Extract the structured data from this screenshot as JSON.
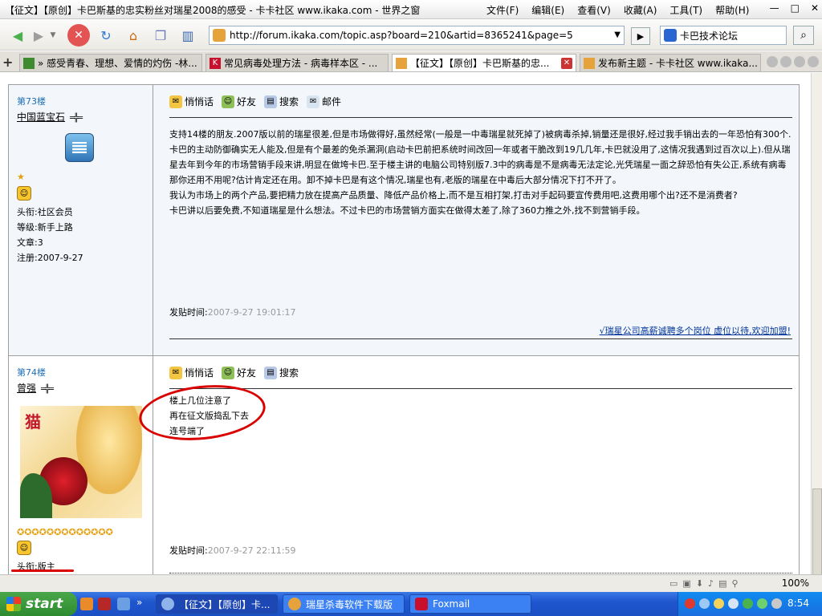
{
  "window": {
    "title": "【征文】【原创】卡巴斯基的忠实粉丝对瑞星2008的感受 - 卡卡社区 www.ikaka.com - 世界之窗",
    "menus": [
      "文件(F)",
      "编辑(E)",
      "查看(V)",
      "收藏(A)",
      "工具(T)",
      "帮助(H)"
    ],
    "controls": [
      "—",
      "□",
      "✕"
    ]
  },
  "toolbar": {
    "url": "http://forum.ikaka.com/topic.asp?board=210&artid=8365241&page=5",
    "search_text": "卡巴技术论坛"
  },
  "tabs": [
    {
      "label": "» 感受青春、理想、爱情的灼伤 -林...",
      "icon_color": "#3e8a2e"
    },
    {
      "label": "常见病毒处理方法 - 病毒样本区 - ...",
      "icon_color": "#c8102e"
    },
    {
      "label": "【征文】【原创】卡巴斯基的忠...",
      "icon_color": "#e7a33b",
      "active": true
    },
    {
      "label": "发布新主题 - 卡卡社区 www.ikaka...",
      "icon_color": "#e7a33b"
    }
  ],
  "actions": {
    "whisper": "悄悄话",
    "friend": "好友",
    "search": "搜索",
    "mail": "邮件"
  },
  "posts": [
    {
      "floor": "第73楼",
      "username": "中国蓝宝石",
      "title": "头衔:社区会员",
      "level": "等级:新手上路",
      "articles": "文章:3",
      "registered": "注册:2007-9-27",
      "body": [
        "支持14楼的朋友.2007版以前的瑞星很差,但是市场做得好,虽然经常(一般是一中毒瑞星就死掉了)被病毒杀掉,销量还是很好,经过我手销出去的一年恐怕有300个.卡巴的主动防御确实无人能及,但是有个最差的免杀漏洞(启动卡巴前把系统时间改回一年或者干脆改到19几几年,卡巴就没用了,这情况我遇到过百次以上).但从瑞星去年到今年的市场营销手段来讲,明显在做垮卡巴.至于楼主讲的电脑公司特别版7.3中的病毒是不是病毒无法定论,光凭瑞星一面之辞恐怕有失公正,系统有病毒那你还用不用呢?估计肯定还在用。卸不掉卡巴是有这个情况,瑞星也有,老版的瑞星在中毒后大部分情况下打不开了。",
        "我认为市场上的两个产品,要把精力放在提高产品质量、降低产品价格上,而不是互相打架,打击对手起码要宣传费用吧,这费用哪个出?还不是消费者?",
        "卡巴讲以后要免费,不知道瑞星是什么想法。不过卡巴的市场营销方面实在做得太差了,除了360力推之外,找不到营销手段。"
      ],
      "post_time_label": "发贴时间:",
      "post_time": "2007-9-27 19:01:17",
      "signature": "√瑞星公司高薪诚聘多个岗位 虚位以待,欢迎加盟!"
    },
    {
      "floor": "第74楼",
      "username": "曾强",
      "title": "头衔:版主",
      "avatar_text": "猫",
      "body": [
        "楼上几位注意了",
        "再在征文版捣乱下去",
        "连号端了"
      ],
      "post_time_label": "发贴时间:",
      "post_time": "2007-9-27 22:11:59"
    }
  ],
  "status": {
    "zoom": "100%"
  },
  "taskbar": {
    "start": "start",
    "tasks": [
      "【征文】【原创】卡...",
      "瑞星杀毒软件下载版",
      "Foxmail"
    ],
    "clock": "8:54"
  },
  "colors": {
    "taskbar": "#1f56cf",
    "start": "#2e8b2f",
    "link": "#003399",
    "annotation": "#d90000"
  }
}
